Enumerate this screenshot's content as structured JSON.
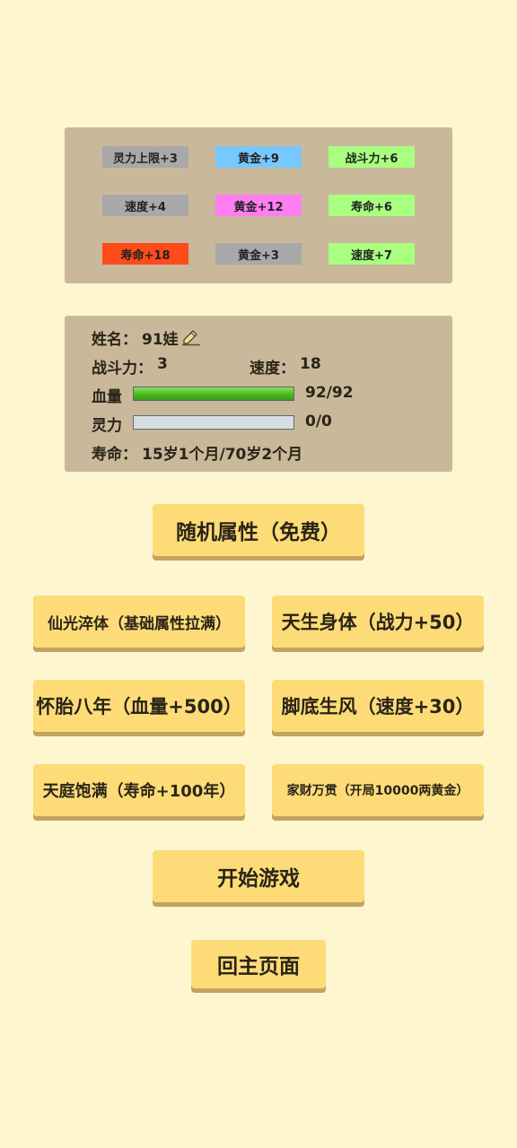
{
  "attributes": [
    {
      "label": "灵力上限+3",
      "color": "#a9a9a9"
    },
    {
      "label": "黄金+9",
      "color": "#76c8ff"
    },
    {
      "label": "战斗力+6",
      "color": "#a8ff80"
    },
    {
      "label": "速度+4",
      "color": "#a9a9a9"
    },
    {
      "label": "黄金+12",
      "color": "#ff7ef0"
    },
    {
      "label": "寿命+6",
      "color": "#a8ff80"
    },
    {
      "label": "寿命+18",
      "color": "#ff4a1c"
    },
    {
      "label": "黄金+3",
      "color": "#a9a9a9"
    },
    {
      "label": "速度+7",
      "color": "#a8ff80"
    }
  ],
  "info": {
    "name_label": "姓名：",
    "name_value": "91娃",
    "edit_icon": "pencil-edit-icon",
    "power_label": "战斗力：",
    "power_value": "3",
    "speed_label": "速度：",
    "speed_value": "18",
    "hp_label": "血量",
    "hp_text": "92/92",
    "hp_fraction": 1.0,
    "mp_label": "灵力",
    "mp_text": "0/0",
    "mp_fraction": 0,
    "life_label": "寿命：",
    "life_value": "15岁1个月/70岁2个月"
  },
  "buttons": {
    "random": "随机属性（免费）",
    "perk1": "仙光淬体（基础属性拉满）",
    "perk2": "天生身体（战力+50）",
    "perk3": "怀胎八年（血量+500）",
    "perk4": "脚底生风（速度+30）",
    "perk5": "天庭饱满（寿命+100年）",
    "perk6": "家财万贯（开局10000两黄金）",
    "start": "开始游戏",
    "home": "回主页面"
  }
}
